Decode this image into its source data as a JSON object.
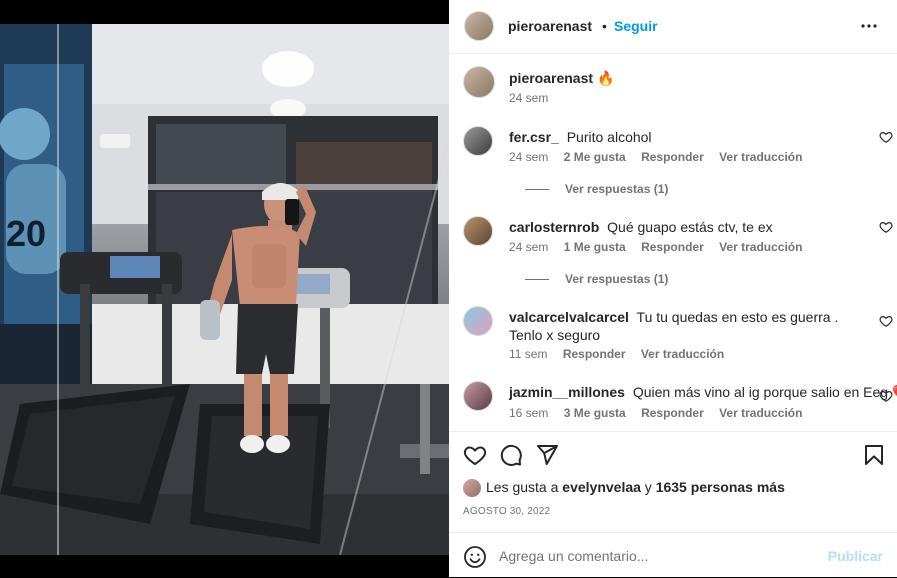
{
  "post": {
    "author": "pieroarenast",
    "dot": "•",
    "follow_label": "Seguir",
    "caption_text": "pieroarenast",
    "caption_emoji": "🔥",
    "caption_time": "24 sem"
  },
  "comments": [
    {
      "user": "fer.csr_",
      "text": "Purito alcohol",
      "time": "24 sem",
      "likes": "2 Me gusta",
      "reply": "Responder",
      "translate": "Ver traducción",
      "replies": "Ver respuestas (1)"
    },
    {
      "user": "carlosternrob",
      "text": "Qué guapo estás ctv, te ex",
      "time": "24 sem",
      "likes": "1 Me gusta",
      "reply": "Responder",
      "translate": "Ver traducción",
      "replies": "Ver respuestas (1)"
    },
    {
      "user": "valcarcelvalcarcel",
      "text": "Tu tu quedas en esto es guerra . Tenlo x seguro",
      "time": "11 sem",
      "likes": "",
      "reply": "Responder",
      "translate": "Ver traducción",
      "replies": ""
    },
    {
      "user": "jazmin__millones",
      "text": "Quien más vino al ig porque salio en Eeg",
      "emoji": "❤️",
      "time": "16 sem",
      "likes": "3 Me gusta",
      "reply": "Responder",
      "translate": "Ver traducción",
      "replies": ""
    }
  ],
  "likes": {
    "prefix": "Les gusta a",
    "user": "evelynvelaa",
    "conj": "y",
    "others": "1635 personas más"
  },
  "date": "AGOSTO 30, 2022",
  "add_comment": {
    "placeholder": "Agrega un comentario...",
    "publish_label": "Publicar"
  },
  "icons": {
    "more": "more-horizontal-icon",
    "like": "heart-icon",
    "comment": "comment-icon",
    "share": "send-icon",
    "save": "bookmark-icon",
    "emoji": "emoji-icon"
  },
  "colors": {
    "accent": "#0095f6",
    "publish_disabled": "#b2dffc",
    "secondary_text": "#737373",
    "heart": "#ed4956"
  }
}
